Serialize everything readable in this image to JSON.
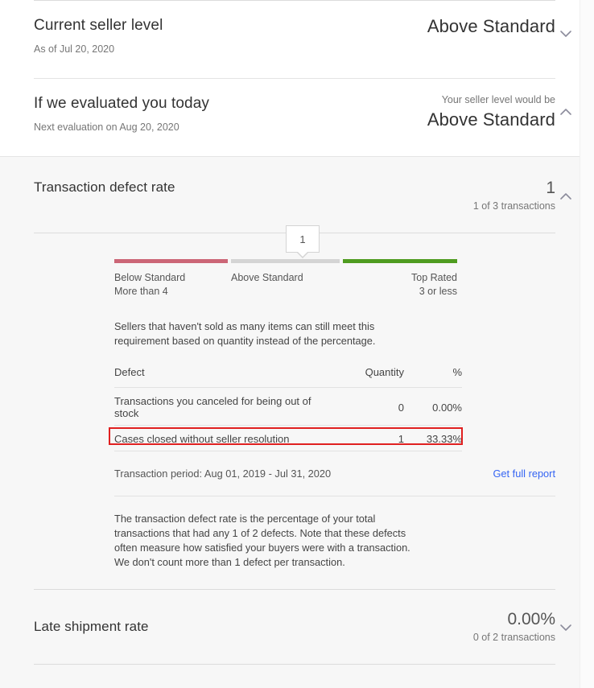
{
  "colors": {
    "below_standard": "#cc6677",
    "above_standard": "#d4d4d4",
    "top_rated": "#4f9c20",
    "link": "#3665f3",
    "highlight": "#e02020",
    "panel_bg": "#ffffff",
    "page_bg": "#f7f7f7"
  },
  "seller_level": {
    "title": "Current seller level",
    "subtitle": "As of Jul 20, 2020",
    "value": "Above Standard",
    "chevron": "chevron-down-icon"
  },
  "evaluation": {
    "title": "If we evaluated you today",
    "subtitle": "Next evaluation on Aug 20, 2020",
    "caption": "Your seller level would be",
    "value": "Above Standard",
    "chevron": "chevron-up-icon"
  },
  "defect_rate": {
    "name": "Transaction defect rate",
    "value": "1",
    "sub": "1 of 3 transactions",
    "chevron": "chevron-up-icon",
    "gauge": {
      "marker_value": "1",
      "segments": [
        {
          "label": "Below Standard",
          "sub": "More than 4",
          "color": "#cc6677"
        },
        {
          "label": "Above Standard",
          "sub": "",
          "color": "#d4d4d4"
        },
        {
          "label": "Top Rated",
          "sub": "3 or less",
          "color": "#4f9c20"
        }
      ]
    },
    "note": "Sellers that haven't sold as many items can still meet this requirement based on quantity instead of the percentage.",
    "table": {
      "headers": [
        "Defect",
        "Quantity",
        "%"
      ],
      "rows": [
        {
          "defect": "Transactions you canceled for being out of stock",
          "quantity": "0",
          "percent": "0.00%",
          "highlighted": false
        },
        {
          "defect": "Cases closed without seller resolution",
          "quantity": "1",
          "percent": "33.33%",
          "highlighted": true
        }
      ]
    },
    "period": "Transaction period: Aug 01, 2019 - Jul 31, 2020",
    "report_link": "Get full report",
    "description": "The transaction defect rate is the percentage of your total transactions that had any 1 of 2 defects. Note that these defects often measure how satisfied your buyers were with a transaction. We don't count more than 1 defect per transaction."
  },
  "late_shipment": {
    "name": "Late shipment rate",
    "value": "0.00%",
    "sub": "0 of 2 transactions",
    "chevron": "chevron-down-icon"
  }
}
